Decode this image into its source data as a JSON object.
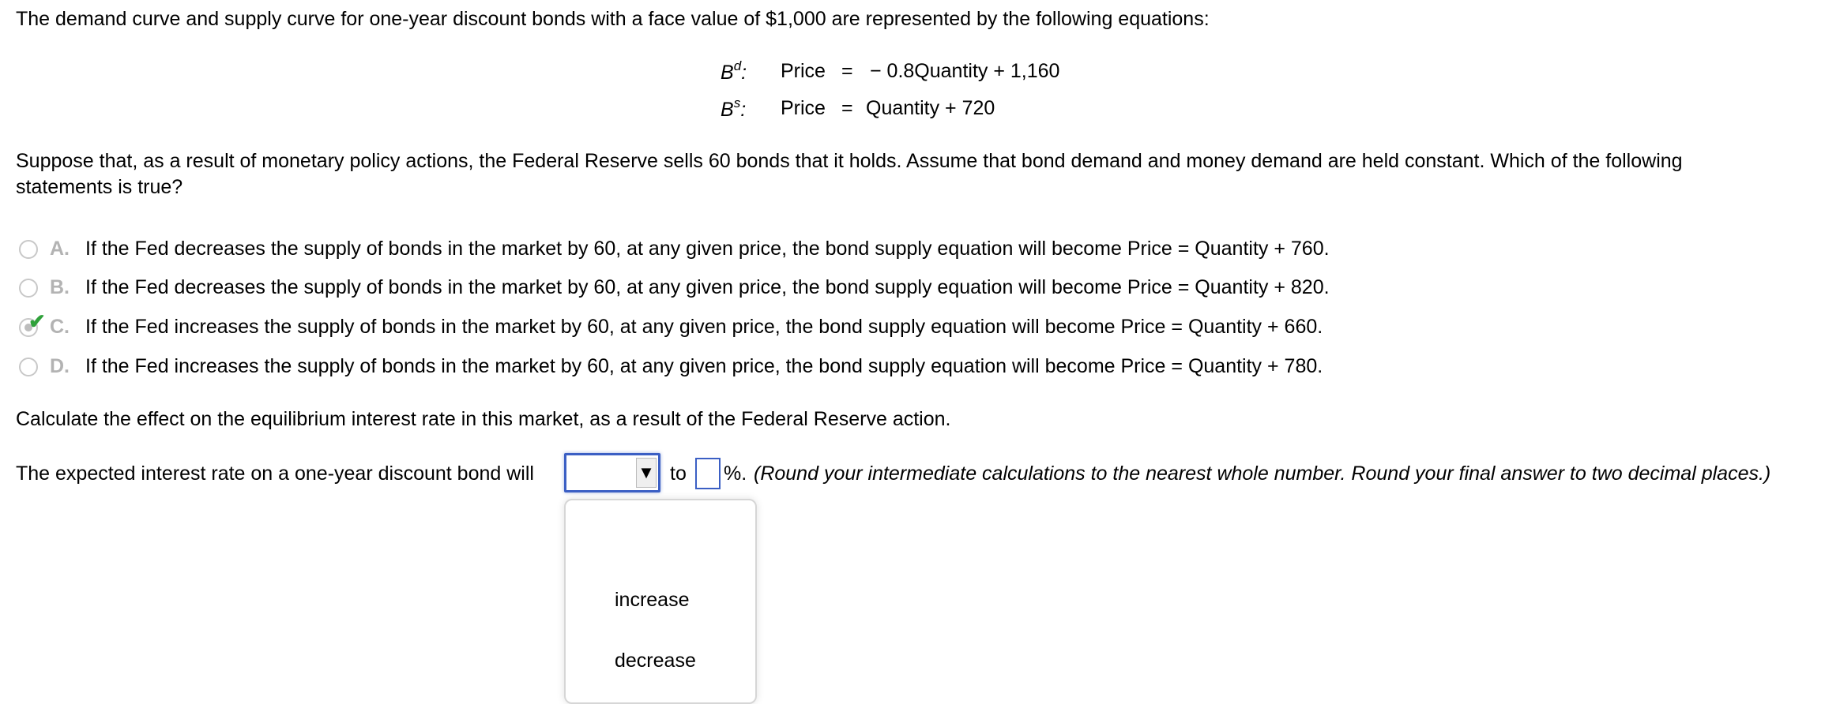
{
  "intro": "The demand curve and supply curve for one-year discount bonds with a face value of $1,000 are represented by the following equations:",
  "equations": [
    {
      "label": "B",
      "sup": "d",
      "lhs": "Price",
      "eq": "=",
      "rhs": "− 0.8Quantity + 1,160"
    },
    {
      "label": "B",
      "sup": "s",
      "lhs": "Price",
      "eq": "=",
      "rhs": "Quantity + 720"
    }
  ],
  "question_line1": "Suppose that, as a result of monetary policy actions, the Federal Reserve sells 60 bonds that it holds. Assume that bond demand and money demand are held constant. Which of the following",
  "question_line2": "statements is true?",
  "options": [
    {
      "letter": "A.",
      "text": "If the Fed decreases the supply of bonds in the market by 60, at any given price, the bond supply equation will become Price = Quantity + 760.",
      "selected": false
    },
    {
      "letter": "B.",
      "text": "If the Fed decreases the supply of bonds in the market by 60, at any given price, the bond supply equation will become Price = Quantity + 820.",
      "selected": false
    },
    {
      "letter": "C.",
      "text": "If the Fed increases the supply of bonds in the market by 60, at any given price, the bond supply equation will become Price = Quantity + 660.",
      "selected": true
    },
    {
      "letter": "D.",
      "text": "If the Fed increases the supply of bonds in the market by 60, at any given price, the bond supply equation will become Price = Quantity + 780.",
      "selected": false
    }
  ],
  "check_glyph": "✔",
  "calc_prompt": "Calculate the effect on the equilibrium interest rate in this market, as a result of the Federal Reserve action.",
  "answer_line": {
    "prefix": "The expected interest rate on a one-year discount bond will",
    "select_value": "",
    "arrow_glyph": "▼",
    "to": "to",
    "input_value": "",
    "suffix": "%.",
    "instruction": "(Round your intermediate calculations to the nearest whole number. Round your final answer to two decimal places.)"
  },
  "dropdown_options": [
    "increase",
    "decrease"
  ]
}
